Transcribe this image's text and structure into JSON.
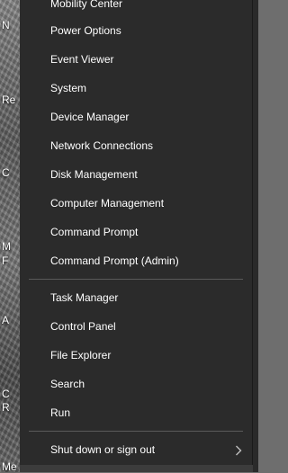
{
  "desktop": {
    "fragments": [
      "N",
      "Re",
      "C",
      "M",
      "F",
      "A",
      "C",
      "R",
      "Me"
    ]
  },
  "menu": {
    "group1": [
      "Mobility Center",
      "Power Options",
      "Event Viewer",
      "System",
      "Device Manager",
      "Network Connections",
      "Disk Management",
      "Computer Management",
      "Command Prompt",
      "Command Prompt (Admin)"
    ],
    "group2": [
      "Task Manager",
      "Control Panel",
      "File Explorer",
      "Search",
      "Run"
    ],
    "group3": {
      "label": "Shut down or sign out",
      "submenu_icon": "chevron-right-icon"
    }
  }
}
